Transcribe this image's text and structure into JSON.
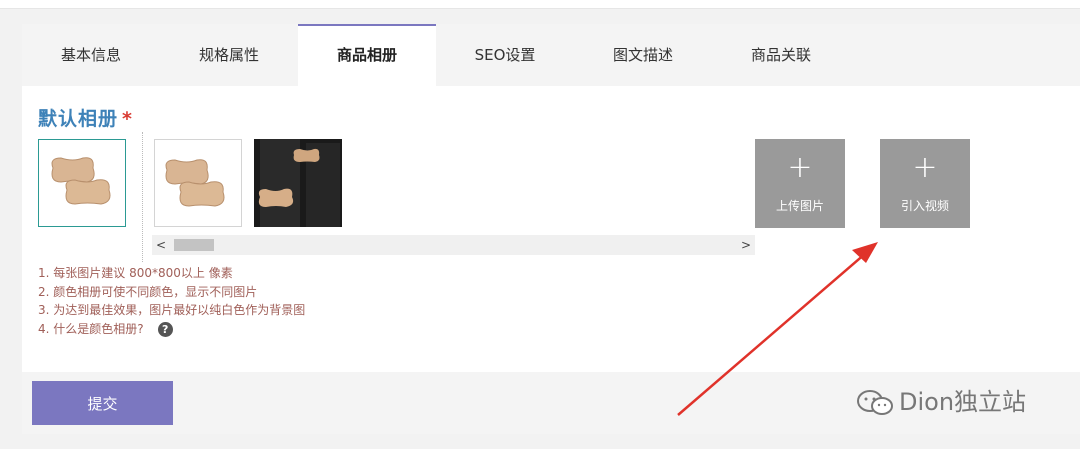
{
  "tabs": [
    {
      "label": "基本信息"
    },
    {
      "label": "规格属性"
    },
    {
      "label": "商品相册"
    },
    {
      "label": "SEO设置"
    },
    {
      "label": "图文描述"
    },
    {
      "label": "商品关联"
    }
  ],
  "album": {
    "title": "默认相册",
    "required_mark": "*",
    "upload_image_label": "上传图片",
    "import_video_label": "引入视频",
    "plus_symbol": "+"
  },
  "scroll": {
    "left_arrow": "<",
    "right_arrow": ">"
  },
  "tips": [
    "1. 每张图片建议 800*800以上 像素",
    "2. 颜色相册可使不同颜色，显示不同图片",
    "3. 为达到最佳效果，图片最好以纯白色作为背景图",
    "4. 什么是颜色相册?"
  ],
  "help_icon": "?",
  "submit_label": "提交",
  "watermark": "Dion独立站",
  "colors": {
    "accent": "#7b77c0",
    "title": "#3e82b8",
    "required": "#d93a32",
    "tips": "#a05f58",
    "arrow": "#e0322a"
  }
}
